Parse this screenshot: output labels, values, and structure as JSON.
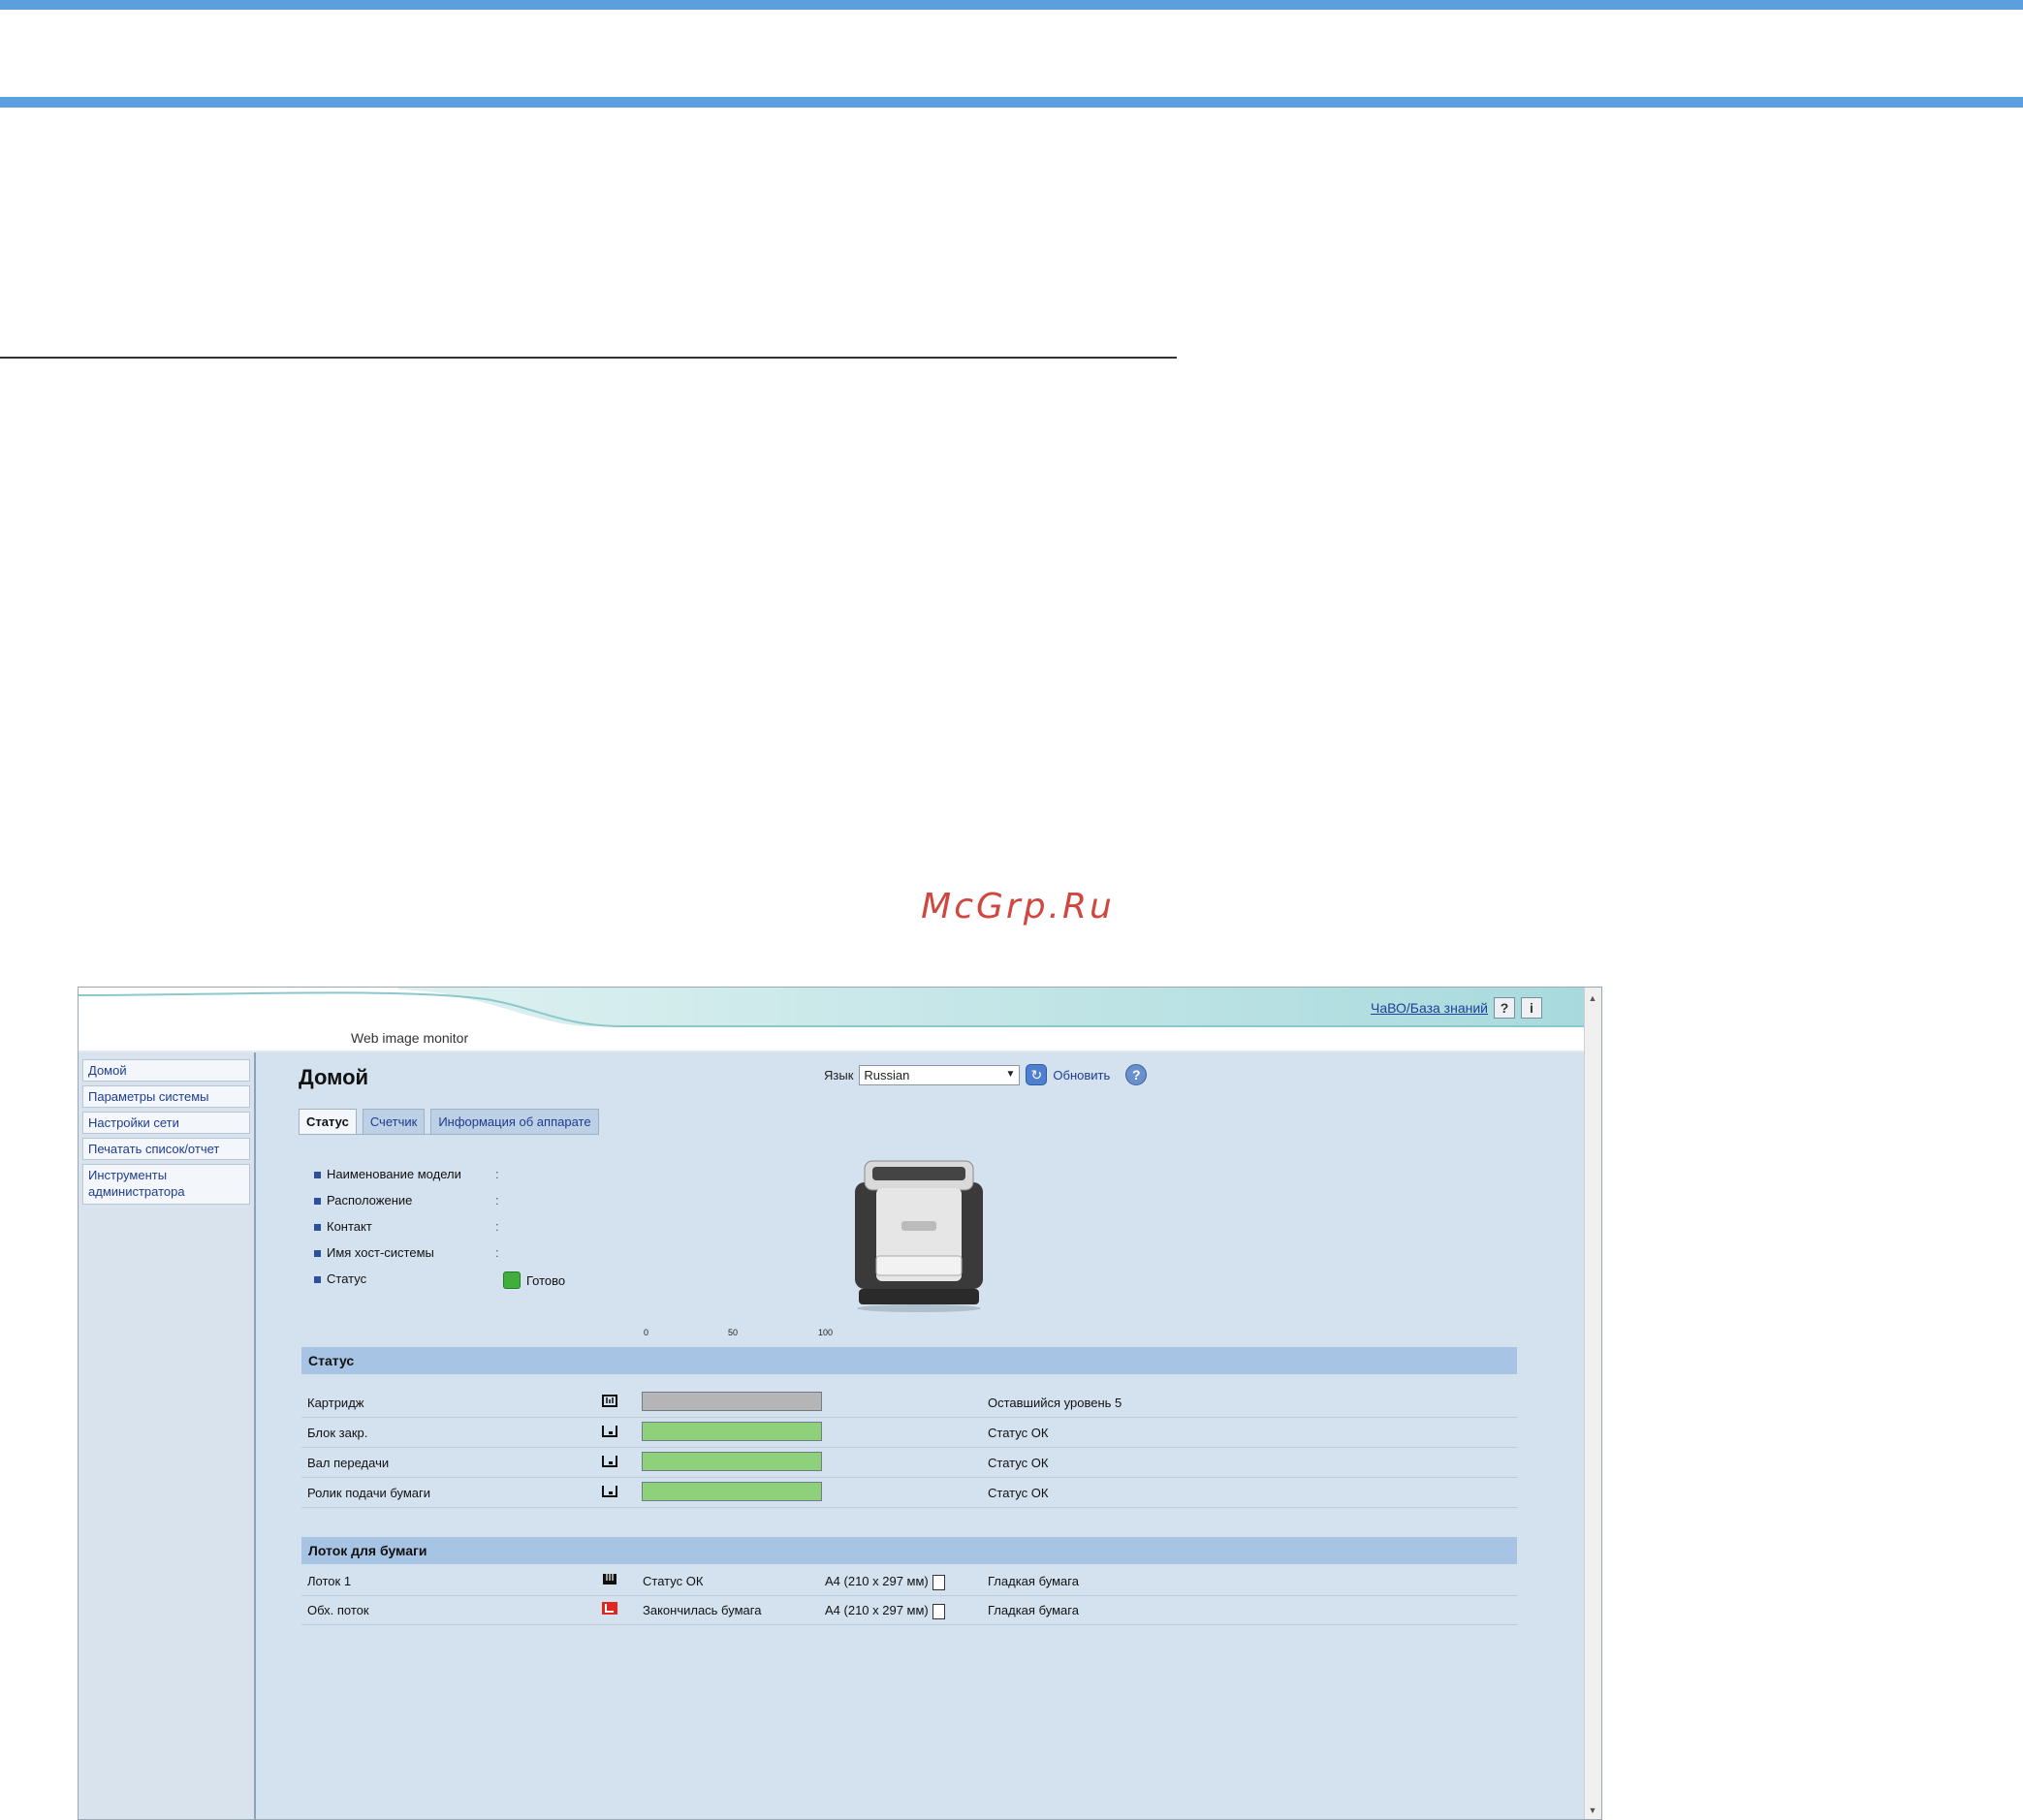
{
  "watermark": "McGrp.Ru",
  "header": {
    "brand": "Web image monitor",
    "faq_link": "ЧаВО/База знаний",
    "help_button": "?",
    "info_button": "i"
  },
  "sidebar": {
    "items": [
      {
        "label": "Домой"
      },
      {
        "label": "Параметры системы"
      },
      {
        "label": "Настройки сети"
      },
      {
        "label": "Печатать список/отчет"
      },
      {
        "label": "Инструменты администратора"
      }
    ]
  },
  "main": {
    "title": "Домой",
    "language_label": "Язык",
    "language_value": "Russian",
    "refresh_label": "Обновить",
    "tabs": [
      {
        "label": "Статус",
        "active": true
      },
      {
        "label": "Счетчик",
        "active": false
      },
      {
        "label": "Информация об аппарате",
        "active": false
      }
    ],
    "info": {
      "model_label": "Наименование модели",
      "location_label": "Расположение",
      "contact_label": "Контакт",
      "host_label": "Имя хост-системы",
      "status_label": "Статус",
      "colon": ":",
      "status_value": "Готово"
    },
    "status_section": {
      "title": "Статус",
      "scale": [
        "0",
        "50",
        "100"
      ],
      "rows": [
        {
          "label": "Картридж",
          "icon": "toner-icon",
          "level": 100,
          "color": "#b5b5b5",
          "status": "Оставшийся уровень 5"
        },
        {
          "label": "Блок закр.",
          "icon": "unit-icon",
          "level": 100,
          "color": "#8ed17a",
          "status": "Статус ОК"
        },
        {
          "label": "Вал передачи",
          "icon": "unit-icon",
          "level": 100,
          "color": "#8ed17a",
          "status": "Статус ОК"
        },
        {
          "label": "Ролик подачи бумаги",
          "icon": "unit-icon",
          "level": 100,
          "color": "#8ed17a",
          "status": "Статус ОК"
        }
      ]
    },
    "tray_section": {
      "title": "Лоток для бумаги",
      "rows": [
        {
          "label": "Лоток 1",
          "icon": "tray-ok-icon",
          "status": "Статус ОК",
          "size": "A4 (210 x 297 мм)",
          "type": "Гладкая бумага"
        },
        {
          "label": "Обх. поток",
          "icon": "tray-empty-icon",
          "status": "Закончилась бумага",
          "size": "A4 (210 x 297 мм)",
          "type": "Гладкая бумага"
        }
      ]
    }
  }
}
